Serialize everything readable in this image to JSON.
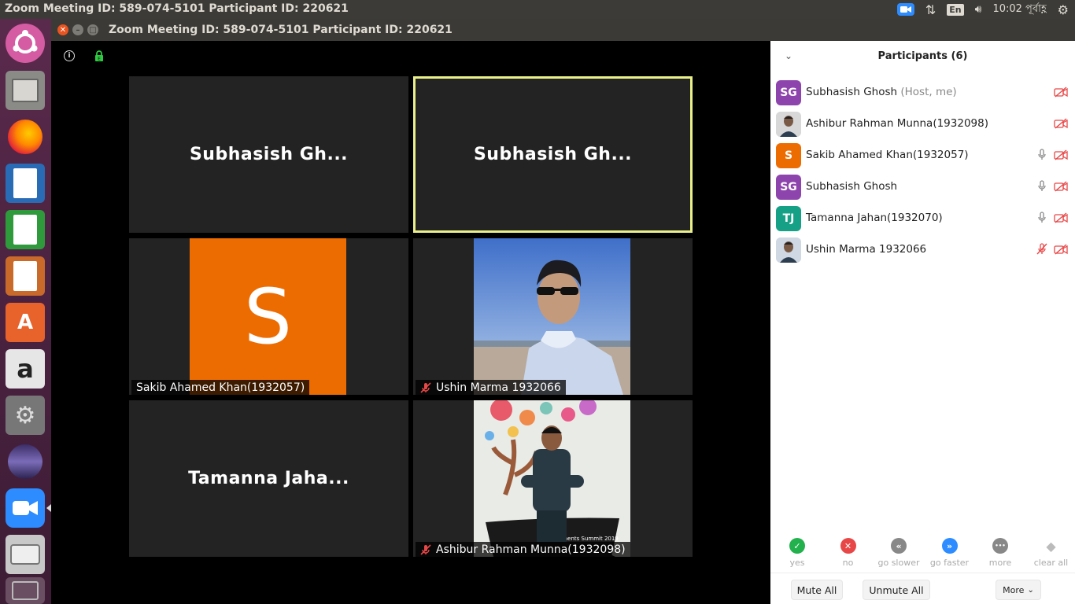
{
  "system_bar": {
    "title": "Zoom Meeting ID: 589-074-5101 Participant ID: 220621",
    "language": "En",
    "clock": "10:02 পূর্বাহ্ণ"
  },
  "window": {
    "title": "Zoom Meeting ID: 589-074-5101 Participant ID: 220621"
  },
  "launcher": {
    "items": [
      "ubuntu-logo",
      "files",
      "firefox",
      "writer",
      "calc",
      "impress",
      "software-center",
      "amazon",
      "system-settings",
      "eclipse",
      "zoom",
      "disk",
      "trash"
    ]
  },
  "gallery": {
    "tiles": [
      {
        "name": "Subhasish Gh...",
        "active": false
      },
      {
        "name": "Subhasish Gh...",
        "active": true
      },
      {
        "name": "Sakib Ahamed Khan(1932057)",
        "avatar_letter": "S"
      },
      {
        "name": "Ushin Marma 1932066",
        "muted": true
      },
      {
        "name": "Tamanna Jaha..."
      },
      {
        "name": "Ashibur Rahman Munna(1932098)",
        "muted": true
      }
    ],
    "colors": {
      "active_border": "#e9f08a",
      "avatar_orange": "#ed6c02"
    }
  },
  "participants": {
    "title": "Participants (6)",
    "list": [
      {
        "initials": "SG",
        "name": "Subhasish Ghosh",
        "sub": " (Host, me)",
        "color": "#8e44ad",
        "mic": "none",
        "cam": "off"
      },
      {
        "initials": "",
        "name": "Ashibur Rahman Munna(1932098)",
        "sub": "",
        "color": "#d8d8d8",
        "mic": "none",
        "cam": "off"
      },
      {
        "initials": "S",
        "name": "Sakib Ahamed Khan(1932057)",
        "sub": "",
        "color": "#ed6c02",
        "mic": "on",
        "cam": "off"
      },
      {
        "initials": "SG",
        "name": "Subhasish Ghosh",
        "sub": "",
        "color": "#8e44ad",
        "mic": "on",
        "cam": "off"
      },
      {
        "initials": "TJ",
        "name": "Tamanna Jahan(1932070)",
        "sub": "",
        "color": "#16a085",
        "mic": "on",
        "cam": "off"
      },
      {
        "initials": "",
        "name": "Ushin Marma 1932066",
        "sub": "",
        "color": "#cfd8e3",
        "mic": "muted",
        "cam": "off"
      }
    ],
    "reactions": [
      {
        "label": "yes",
        "color": "#23b14d"
      },
      {
        "label": "no",
        "color": "#e84747"
      },
      {
        "label": "go slower",
        "color": "#888888"
      },
      {
        "label": "go faster",
        "color": "#2d8cff"
      },
      {
        "label": "more",
        "color": "#888888"
      },
      {
        "label": "clear all",
        "color": "#bbbbbb"
      }
    ],
    "footer": {
      "mute_all": "Mute All",
      "unmute_all": "Unmute All",
      "more": "More"
    }
  }
}
